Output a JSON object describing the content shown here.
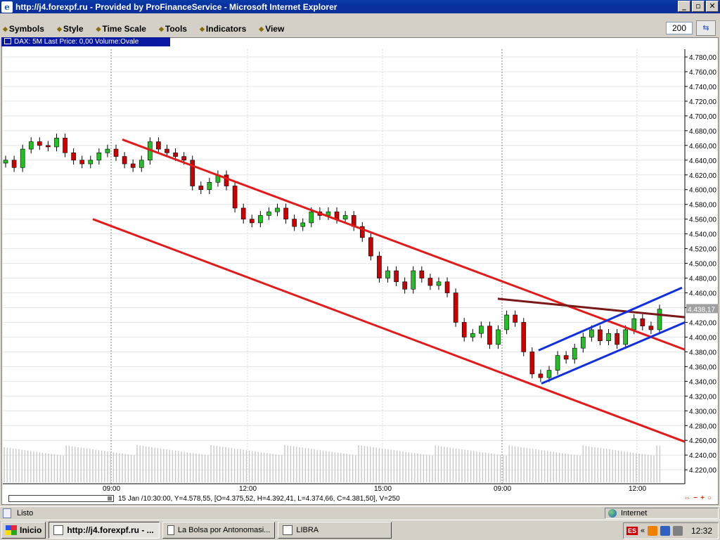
{
  "window": {
    "title": "http://j4.forexpf.ru - Provided by ProFinanceService - Microsoft Internet Explorer"
  },
  "menu": [
    {
      "label": "Symbols"
    },
    {
      "label": "Style"
    },
    {
      "label": "Time Scale"
    },
    {
      "label": "Tools"
    },
    {
      "label": "Indicators"
    },
    {
      "label": "View"
    }
  ],
  "zoom_value": "200",
  "chart_header": "DAX: 5M Last Price: 0,00 Volume:Ovale",
  "chart_data": {
    "type": "candlestick",
    "symbol": "DAX",
    "ylim": [
      4200,
      4790
    ],
    "y_ticks": [
      "4.780,00",
      "4.760,00",
      "4.740,00",
      "4.720,00",
      "4.700,00",
      "4.680,00",
      "4.660,00",
      "4.640,00",
      "4.620,00",
      "4.600,00",
      "4.580,00",
      "4.560,00",
      "4.540,00",
      "4.520,00",
      "4.500,00",
      "4.480,00",
      "4.460,00",
      "4.440,00",
      "4.420,00",
      "4.400,00",
      "4.380,00",
      "4.360,00",
      "4.340,00",
      "4.320,00",
      "4.300,00",
      "4.280,00",
      "4.260,00",
      "4.240,00",
      "4.220,00"
    ],
    "x_ticks": [
      "09:00",
      "12:00",
      "15:00",
      "09:00",
      "12:00"
    ],
    "last_price_label": "4.438,17",
    "last_price": 4438.17,
    "closes": [
      4640,
      4630,
      4655,
      4665,
      4660,
      4658,
      4670,
      4650,
      4640,
      4635,
      4640,
      4650,
      4655,
      4645,
      4635,
      4630,
      4640,
      4665,
      4655,
      4650,
      4645,
      4640,
      4605,
      4600,
      4610,
      4620,
      4605,
      4575,
      4560,
      4555,
      4565,
      4570,
      4575,
      4560,
      4550,
      4555,
      4570,
      4565,
      4570,
      4560,
      4565,
      4550,
      4535,
      4510,
      4480,
      4490,
      4475,
      4465,
      4490,
      4480,
      4470,
      4475,
      4460,
      4420,
      4400,
      4405,
      4415,
      4390,
      4410,
      4430,
      4420,
      4380,
      4350,
      4345,
      4355,
      4375,
      4370,
      4385,
      4400,
      4410,
      4395,
      4405,
      4390,
      4410,
      4425,
      4415,
      4410,
      4438
    ]
  },
  "status_info": "15 Jan /10:30:00, Y=4.578,55, [O=4.375,52, H=4.392,41, L=4.374,66, C=4.381,50], V=250",
  "ie_status": {
    "text": "Listo",
    "zone": "Internet"
  },
  "taskbar": {
    "start": "Inicio",
    "tasks": [
      {
        "label": "http://j4.forexpf.ru - ..."
      },
      {
        "label": "La Bolsa por Antonomasi..."
      },
      {
        "label": "LIBRA"
      }
    ],
    "tray_lang": "ES",
    "tray_arrow": "«",
    "clock": "12:32"
  }
}
